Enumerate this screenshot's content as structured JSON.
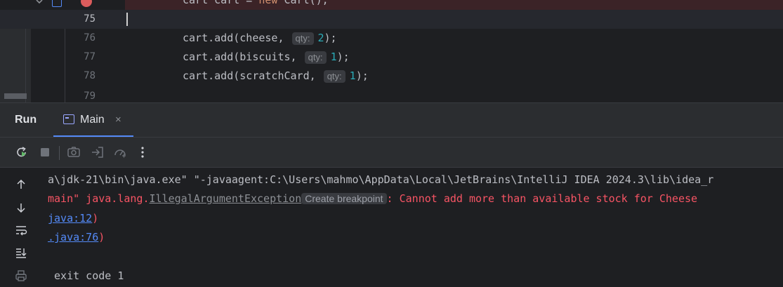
{
  "editor": {
    "lines": [
      {
        "num": "",
        "code_parts": [
          {
            "text": "cart cart = ",
            "cls": ""
          },
          {
            "text": "new",
            "cls": "kw"
          },
          {
            "text": " Cart();",
            "cls": ""
          }
        ]
      },
      {
        "num": "75"
      },
      {
        "num": "76",
        "code_before": "cart.add(cheese, ",
        "hint": "qty:",
        "value": "2",
        "code_after": ");"
      },
      {
        "num": "77",
        "code_before": "cart.add(biscuits, ",
        "hint": "qty:",
        "value": "1",
        "code_after": ");"
      },
      {
        "num": "78",
        "code_before": "cart.add(scratchCard, ",
        "hint": "qty:",
        "value": "1",
        "code_after": ");"
      },
      {
        "num": "79"
      }
    ]
  },
  "tool_window": {
    "title": "Run",
    "tab": {
      "label": "Main",
      "close": "×"
    }
  },
  "toolbar": {
    "icons": [
      "rerun-icon",
      "stop-icon",
      "screenshot-icon",
      "restore-layout-icon",
      "profiler-icon",
      "more-icon"
    ]
  },
  "console": {
    "gutter_icons": [
      "arrow-up-icon",
      "arrow-down-icon",
      "soft-wrap-icon",
      "scroll-to-end-icon",
      "print-icon"
    ],
    "lines": {
      "cmd": "a\\jdk-21\\bin\\java.exe\" \"-javaagent:C:\\Users\\mahmo\\AppData\\Local\\JetBrains\\IntelliJ IDEA 2024.3\\lib\\idea_r",
      "err_prefix": "main\" java.lang.",
      "exception": "IllegalArgumentException",
      "breakpoint_chip": "Create breakpoint",
      "err_message": ": Cannot add more than available stock for Cheese",
      "trace1_link": "java:12",
      "trace1_tail": ")",
      "trace2_link": ".java:76",
      "trace2_tail": ")",
      "exit": " exit code 1"
    }
  },
  "colors": {
    "background": "#1e1f22",
    "panel": "#2b2d30",
    "error": "#f75464",
    "link": "#548af7",
    "number": "#2aacb8",
    "keyword": "#cf8e6d"
  }
}
